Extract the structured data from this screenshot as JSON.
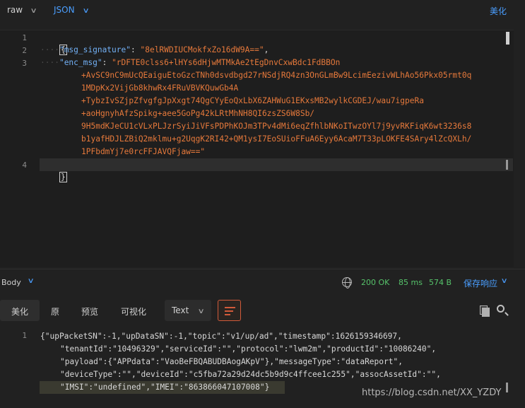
{
  "toolbar": {
    "raw_label": "raw",
    "json_label": "JSON",
    "beautify_label": "美化"
  },
  "request_editor": {
    "line_numbers": [
      "1",
      "2",
      "3",
      "4"
    ],
    "open_brace": "{",
    "close_brace": "}",
    "msg_signature_key": "\"msg_signature\"",
    "msg_signature_value": "\"8elRWDIUCMokfxZo16dW9A==\"",
    "enc_msg_key": "\"enc_msg\"",
    "enc_msg_lines": [
      "\"rDFTE0clss6+lHYs6dHjwMTMkAe2tEgDnvCxwBdc1FdBBOn",
      "+AvSC9nC9mUcQEaiguEtoGzcTNh0dsvdbgd27rNSdjRQ4zn3OnGLmBw9LcimEezivWLhAo56Pkx05rmt0q",
      "1MDpKx2VijGb8khwRx4FRuVBVKQuwGb4A",
      "+TybzIvSZjpZfvgfgJpXxgt74QgCYyEoQxLbX6ZAHWuG1EKxsMB2wylkCGDEJ/wau7igpeRa",
      "+aoHgnyhAfzSpikg+aee5GoPg42kLRtMhNH8QI6zsZS6W8Sb/",
      "9H5mdKJeCU1cVLxPLJzrSyiJiVFsPDPhKOJm3TPv4dMi6eqZfhlbNKoITwzOYl7j9yvRKFiqK6wt3236s8",
      "b1yafHDJLZBiQ2mklmu+g2UqgK2RI42+QM1ysI7EoSUioFFuA6Eyy6AcaM7T33pLOKFE4SAry4lZcQXLh/",
      "1PFbdmYj7e0rcFFJAVQFjaw==\""
    ]
  },
  "body_bar": {
    "label": "Body",
    "status": "200 OK",
    "time": "85 ms",
    "size": "574 B",
    "save_response": "保存响应"
  },
  "response_tabs": {
    "beautify": "美化",
    "raw": "原",
    "preview": "预览",
    "visualize": "可视化",
    "format": "Text"
  },
  "response_viewer": {
    "line_number": "1",
    "lines": [
      "{\"upPacketSN\":-1,\"upDataSN\":-1,\"topic\":\"v1/up/ad\",\"timestamp\":1626159346697,",
      "\"tenantId\":\"10496329\",\"serviceId\":\"\",\"protocol\":\"lwm2m\",\"productId\":\"10086240\",",
      "\"payload\":{\"APPdata\":\"VaoBeFBQABUDBAogAKpV\"},\"messageType\":\"dataReport\",",
      "\"deviceType\":\"\",\"deviceId\":\"c5fba72a29d24dc5b9d9c4ffcee1c255\",\"assocAssetId\":\"\",",
      "\"IMSI\":\"undefined\",\"IMEI\":\"863866047107008\"}"
    ]
  },
  "watermark": "https://blog.csdn.net/XX_YZDY",
  "colors": {
    "accent": "#4a9eff",
    "string": "#e6793b",
    "key": "#72b0f5",
    "success": "#56c26a"
  }
}
